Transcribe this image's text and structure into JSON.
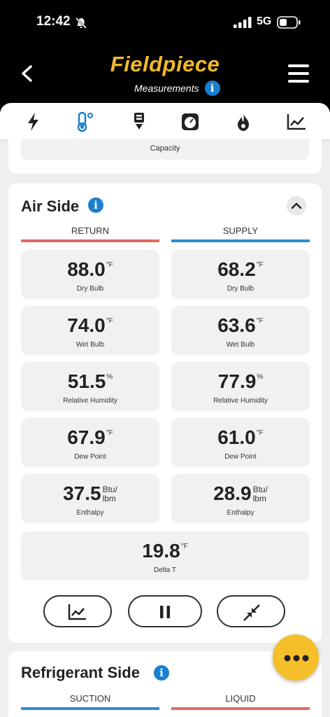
{
  "status_bar": {
    "time": "12:42",
    "network": "5G"
  },
  "header": {
    "logo": "Fieldpiece",
    "subtitle": "Measurements",
    "info_glyph": "i"
  },
  "toolbar": {
    "icons": [
      "lightning-icon",
      "thermometer-icon",
      "probe-icon",
      "gauge-icon",
      "flame-icon",
      "chart-icon"
    ]
  },
  "capacity_card": {
    "label": "Capacity"
  },
  "air_side": {
    "title": "Air Side",
    "info_glyph": "i",
    "columns": {
      "return": {
        "heading": "RETURN",
        "color": "#e06a64"
      },
      "supply": {
        "heading": "SUPPLY",
        "color": "#2a8fd0"
      }
    },
    "rows": [
      {
        "label": "Dry Bulb",
        "return_value": "88.0",
        "supply_value": "68.2",
        "unit": "°F"
      },
      {
        "label": "Wet Bulb",
        "return_value": "74.0",
        "supply_value": "63.6",
        "unit": "°F"
      },
      {
        "label": "Relative Humidity",
        "return_value": "51.5",
        "supply_value": "77.9",
        "unit": "%"
      },
      {
        "label": "Dew Point",
        "return_value": "67.9",
        "supply_value": "61.0",
        "unit": "°F"
      },
      {
        "label": "Enthalpy",
        "return_value": "37.5",
        "supply_value": "28.9",
        "unit_line1": "Btu/",
        "unit_line2": "lbm"
      }
    ],
    "delta": {
      "label": "Delta T",
      "value": "19.8",
      "unit": "°F"
    },
    "actions": [
      "chart-icon",
      "pause-icon",
      "collapse-arrows-icon"
    ]
  },
  "refrigerant_side": {
    "title": "Refrigerant Side",
    "info_glyph": "i",
    "columns": {
      "suction": {
        "heading": "SUCTION",
        "color": "#2a8fd0"
      },
      "liquid": {
        "heading": "LIQUID",
        "color": "#e06a64"
      }
    }
  },
  "fab": {
    "icon": "more-dots-icon"
  },
  "colors": {
    "accent_yellow": "#f3b928",
    "info_blue": "#1a7fd0",
    "return_red": "#e06a64",
    "supply_blue": "#2a8fd0"
  }
}
